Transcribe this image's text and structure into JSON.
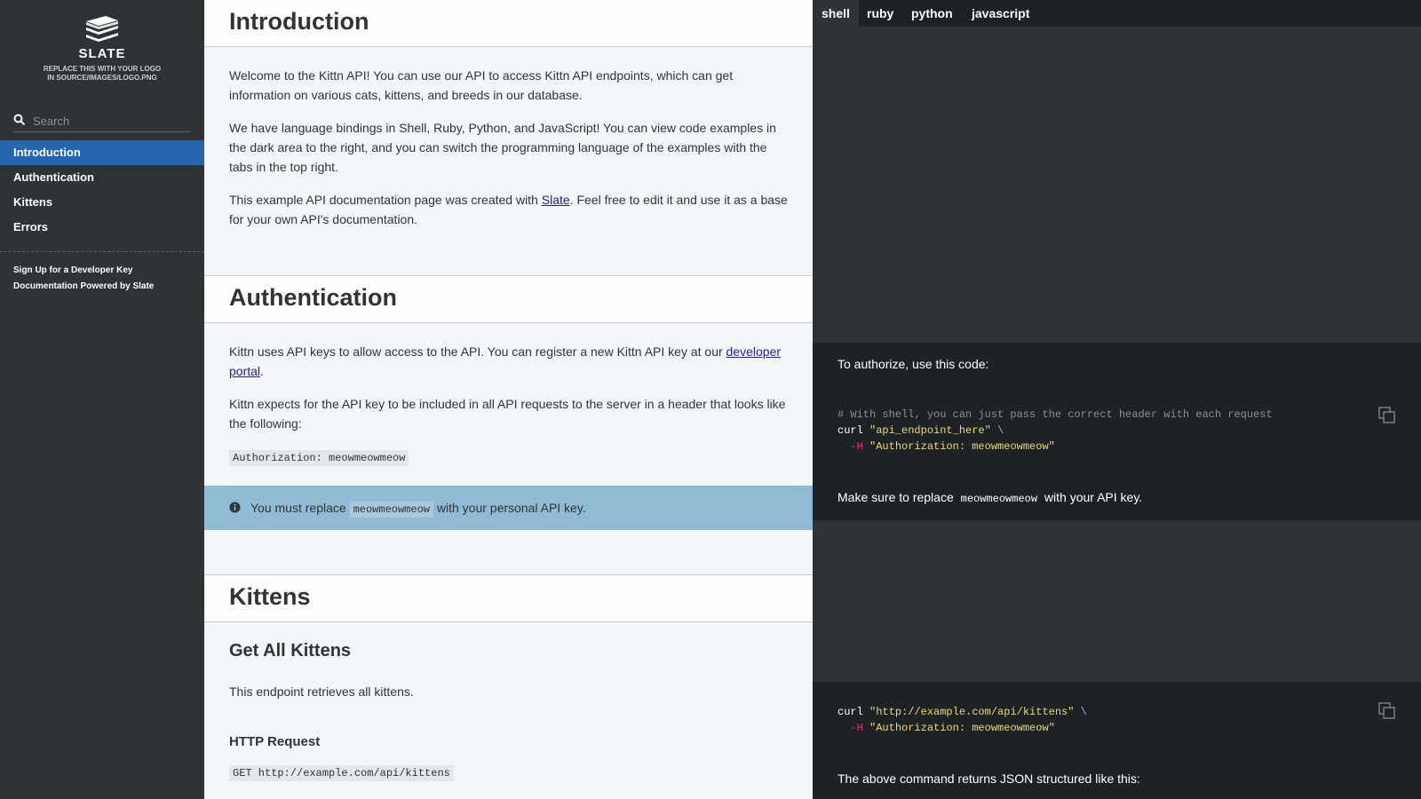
{
  "sidebar": {
    "logo_title": "SLATE",
    "logo_sub_1": "REPLACE THIS WITH YOUR LOGO",
    "logo_sub_2": "IN SOURCE/IMAGES/LOGO.PNG",
    "search_placeholder": "Search",
    "toc": [
      "Introduction",
      "Authentication",
      "Kittens",
      "Errors"
    ],
    "footer_links": [
      "Sign Up for a Developer Key",
      "Documentation Powered by Slate"
    ]
  },
  "content": {
    "intro_title": "Introduction",
    "intro_p1": "Welcome to the Kittn API! You can use our API to access Kittn API endpoints, which can get information on various cats, kittens, and breeds in our database.",
    "intro_p2": "We have language bindings in Shell, Ruby, Python, and JavaScript! You can view code examples in the dark area to the right, and you can switch the programming language of the examples with the tabs in the top right.",
    "intro_p3_before": "This example API documentation page was created with ",
    "intro_p3_link": "Slate",
    "intro_p3_after": ". Feel free to edit it and use it as a base for your own API's documentation.",
    "auth_title": "Authentication",
    "auth_p1_before": "Kittn uses API keys to allow access to the API. You can register a new Kittn API key at our ",
    "auth_p1_link": "developer portal",
    "auth_p1_after": ".",
    "auth_p2": "Kittn expects for the API key to be included in all API requests to the server in a header that looks like the following:",
    "auth_code": "Authorization: meowmeowmeow",
    "notice_before": "You must replace ",
    "notice_code": "meowmeowmeow",
    "notice_after": " with your personal API key.",
    "kittens_title": "Kittens",
    "get_all_title": "Get All Kittens",
    "get_all_desc": "This endpoint retrieves all kittens.",
    "http_request_title": "HTTP Request",
    "http_request_code": "GET http://example.com/api/kittens"
  },
  "code_panel": {
    "tabs": [
      "shell",
      "ruby",
      "python",
      "javascript"
    ],
    "active_tab": "shell",
    "auth_intro": "To authorize, use this code:",
    "auth_comment": "# With shell, you can just pass the correct header with each request",
    "auth_cmd": "curl",
    "auth_url": "\"api_endpoint_here\"",
    "auth_continue": "\\",
    "auth_flag": "-H",
    "auth_header": "\"Authorization: meowmeowmeow\"",
    "replace_before": "Make sure to replace ",
    "replace_code": "meowmeowmeow",
    "replace_after": " with your API key.",
    "kittens_cmd": "curl",
    "kittens_url": "\"http://example.com/api/kittens\"",
    "kittens_continue": "\\",
    "kittens_flag": "-H",
    "kittens_header": "\"Authorization: meowmeowmeow\"",
    "returns_text": "The above command returns JSON structured like this:"
  },
  "colors": {
    "sidebar_bg": "#2e3336",
    "active_nav": "#2467af",
    "notice_bg": "#8fbcd4",
    "code_panel_bg": "#2e3336",
    "string": "#e6db74",
    "flag": "#f92672"
  }
}
